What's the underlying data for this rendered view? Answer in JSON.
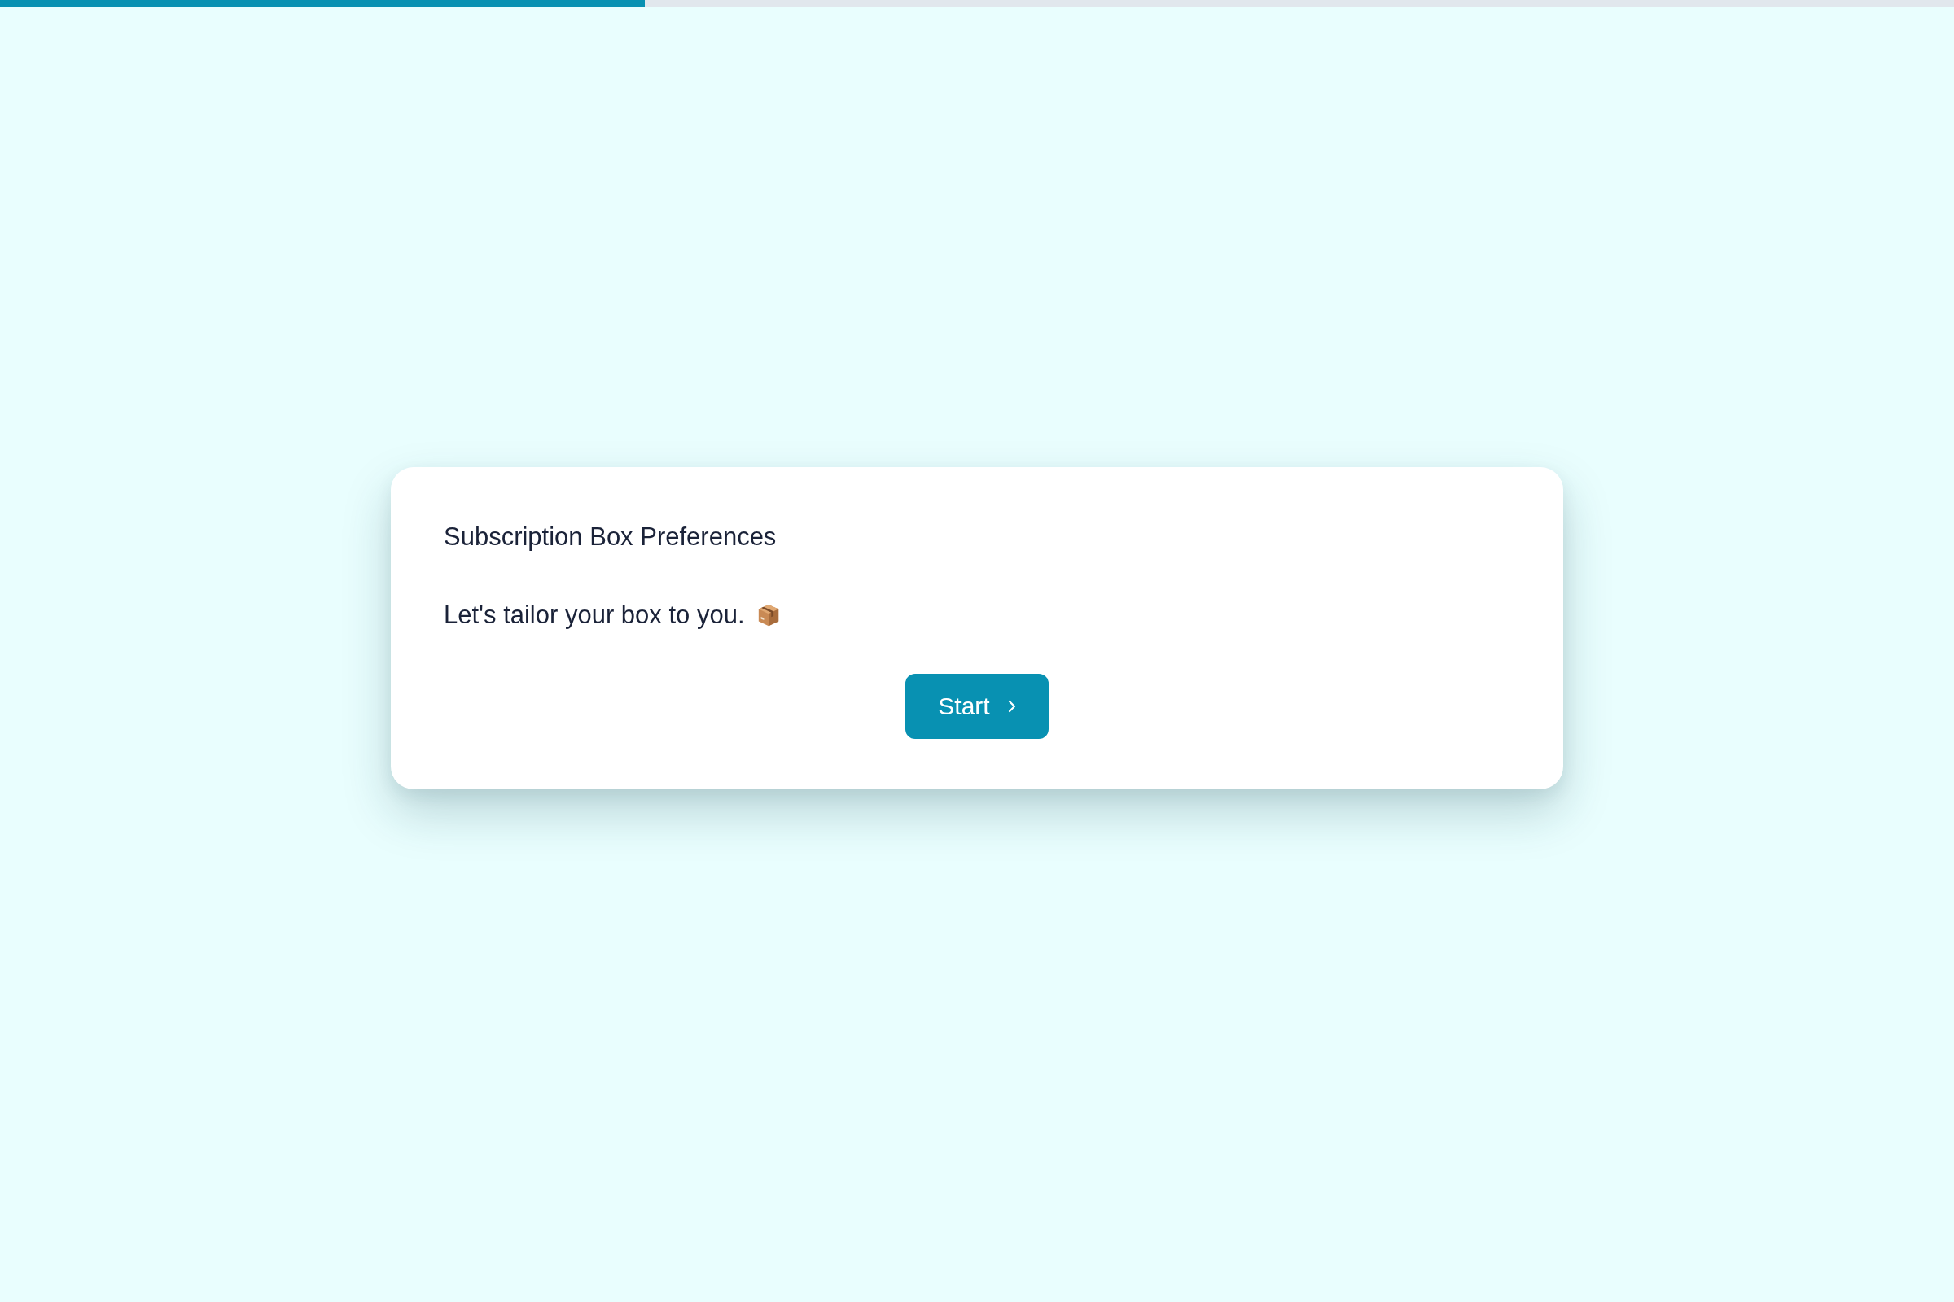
{
  "progress": {
    "level": 0.33
  },
  "card": {
    "title": "Subscription Box Preferences",
    "message": "Let's tailor your box to you.",
    "button": {
      "label": "Start"
    }
  }
}
